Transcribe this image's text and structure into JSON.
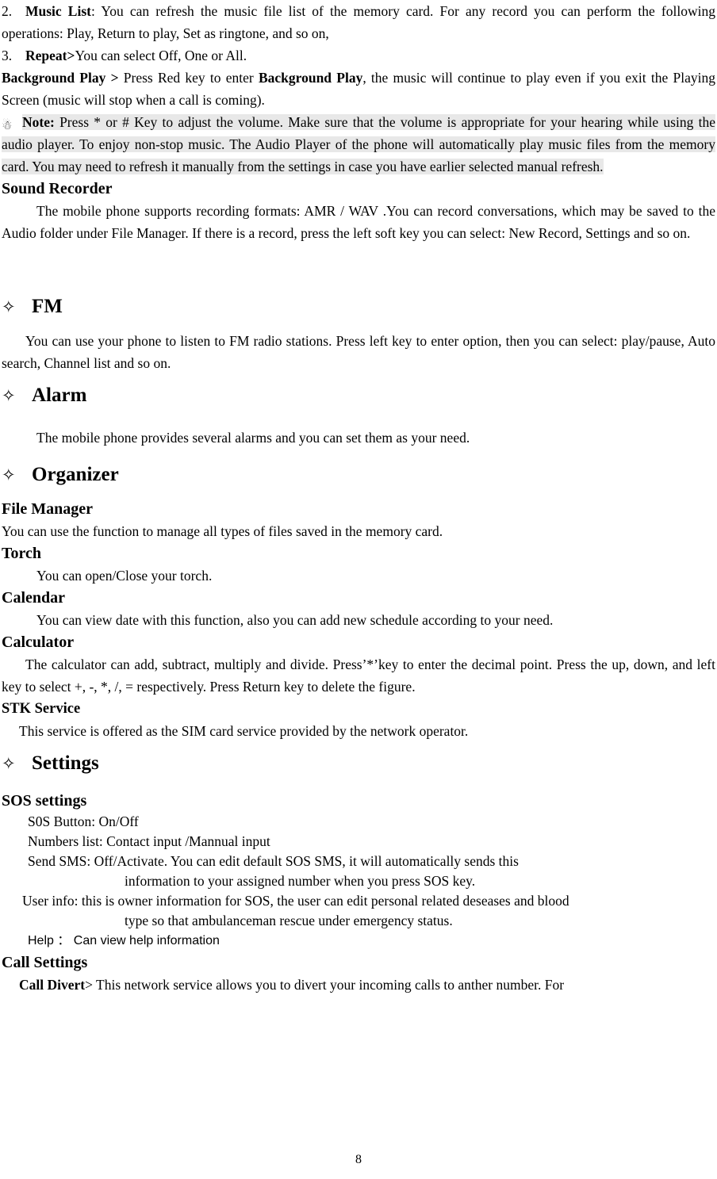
{
  "document": {
    "page_number": "8",
    "highlight_color": "#e8e8e8",
    "text_color": "#000000"
  },
  "music_list": {
    "number": "2.",
    "term": "Music List",
    "body": ": You can refresh the music file list of the memory card. For any record you can perform the following operations: Play, Return to play, Set as ringtone, and so on,"
  },
  "repeat": {
    "number": "3.",
    "term": "Repeat>",
    "body": "You can select Off, One or All."
  },
  "background_play": {
    "term": "Background Play >",
    "body_part1": " Press Red key to enter ",
    "term2": "Background Play",
    "body_part2": ", the music will continue to play even if you exit the Playing Screen (music will stop when a call is coming)."
  },
  "note": {
    "icon": "lightbulb-icon",
    "label": "Note:",
    "text": " Press * or # Key to adjust the volume. Make sure that the volume is appropriate for your hearing while using the audio player. To enjoy non-stop music. The Audio Player of the phone will automatically play music files from the memory card. You may need to refresh it manually from the settings in case you have earlier selected manual refresh."
  },
  "sound_recorder": {
    "heading": "Sound Recorder",
    "body": "The mobile phone supports recording formats: AMR / WAV .You can record conversations, which may be saved to the Audio folder under File Manager. If there is a record, press the left soft key you can select: New Record, Settings and so on."
  },
  "fm": {
    "bullet": "✧",
    "heading": "FM",
    "body": "You can use your phone to listen to FM radio stations. Press left key to enter option, then you can select: play/pause, Auto search, Channel list and so on."
  },
  "alarm": {
    "bullet": "✧",
    "heading": "Alarm",
    "body": "The mobile phone provides several alarms and you can set them as your need."
  },
  "organizer": {
    "bullet": "✧",
    "heading": "Organizer",
    "file_manager": {
      "heading": "File Manager",
      "body": "You can use the function to manage all types of files saved in the memory card."
    },
    "torch": {
      "heading": "Torch",
      "body": "You can open/Close your torch."
    },
    "calendar": {
      "heading": "Calendar",
      "body": "You can view date with this function, also you can add new schedule according to your need."
    },
    "calculator": {
      "heading": "Calculator",
      "body": "The calculator can add, subtract, multiply and divide. Press’*’key to enter the decimal point. Press the up, down, and left key to select +, -, *, /, = respectively. Press Return key to delete the figure."
    },
    "stk_service": {
      "heading": "STK Service",
      "body": "This service is offered as the SIM card service provided by the network operator."
    }
  },
  "settings": {
    "bullet": "✧",
    "heading": "Settings",
    "sos": {
      "heading": "SOS settings",
      "lines": [
        "S0S Button: On/Off",
        "Numbers list: Contact input /Mannual input",
        "Send SMS: Off/Activate. You can edit default SOS SMS, it will automatically sends this",
        "information to your assigned number when you press SOS key.",
        "User info: this is owner information for SOS, the user can edit personal related deseases and blood",
        "type so that ambulanceman rescue under emergency status.",
        "Help  ：  Can view help information"
      ]
    },
    "call_settings": {
      "heading": "Call Settings",
      "divert_term": "Call Divert",
      "divert_body": "> This network service allows you to divert your incoming calls to anther number. For"
    }
  }
}
